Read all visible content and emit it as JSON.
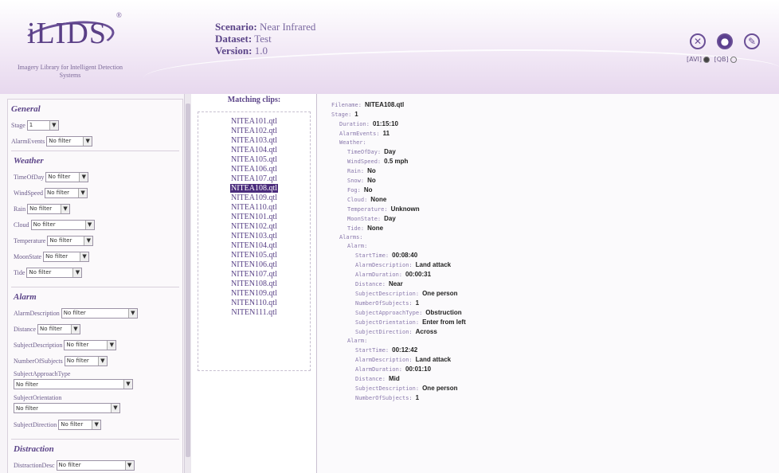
{
  "header": {
    "logo_text": "iLIDS",
    "logo_reg": "®",
    "logo_tagline": "Imagery Library for Intelligent Detection Systems",
    "scenario_label": "Scenario:",
    "scenario_value": "Near Infrared",
    "dataset_label": "Dataset:",
    "dataset_value": "Test",
    "version_label": "Version:",
    "version_value": "1.0",
    "format_options": [
      "[AVI]",
      "[QB]"
    ],
    "icons": [
      "close-icon",
      "record-icon",
      "edit-icon"
    ]
  },
  "filters": {
    "general": {
      "title": "General",
      "stage_label": "Stage",
      "stage_value": "1",
      "alarm_events_label": "AlarmEvents",
      "alarm_events_value": "No filter"
    },
    "weather": {
      "title": "Weather",
      "rows": [
        {
          "label": "TimeOfDay",
          "value": "No filter"
        },
        {
          "label": "WindSpeed",
          "value": "No filter"
        },
        {
          "label": "Rain",
          "value": "No filter"
        },
        {
          "label": "Cloud",
          "value": "No filter"
        },
        {
          "label": "Temperature",
          "value": "No filter"
        },
        {
          "label": "MoonState",
          "value": "No filter"
        },
        {
          "label": "Tide",
          "value": "No filter"
        }
      ]
    },
    "alarm": {
      "title": "Alarm",
      "rows": [
        {
          "label": "AlarmDescription",
          "value": "No filter"
        },
        {
          "label": "Distance",
          "value": "No filter"
        },
        {
          "label": "SubjectDescription",
          "value": "No filter"
        },
        {
          "label": "NumberOfSubjects",
          "value": "No filter"
        }
      ],
      "approach_label": "SubjectApproachType",
      "approach_value": "No filter",
      "orientation_label": "SubjectOrientation",
      "orientation_value": "No filter",
      "direction_label": "SubjectDirection",
      "direction_value": "No filter"
    },
    "distraction": {
      "title": "Distraction",
      "desc_label": "DistractionDesc",
      "desc_value": "No filter"
    }
  },
  "clips": {
    "title": "Matching clips:",
    "items": [
      "NITEA101.qtl",
      "NITEA102.qtl",
      "NITEA103.qtl",
      "NITEA104.qtl",
      "NITEA105.qtl",
      "NITEA106.qtl",
      "NITEA107.qtl",
      "NITEA108.qtl",
      "NITEA109.qtl",
      "NITEA110.qtl",
      "NITEN101.qtl",
      "NITEN102.qtl",
      "NITEN103.qtl",
      "NITEN104.qtl",
      "NITEN105.qtl",
      "NITEN106.qtl",
      "NITEN107.qtl",
      "NITEN108.qtl",
      "NITEN109.qtl",
      "NITEN110.qtl",
      "NITEN111.qtl"
    ],
    "selected_index": 7
  },
  "details": [
    {
      "indent": 0,
      "key": "Filename:",
      "value": "NITEA108.qtl"
    },
    {
      "indent": 0,
      "key": "Stage:",
      "value": "1"
    },
    {
      "indent": 1,
      "key": "Duration:",
      "value": "01:15:10"
    },
    {
      "indent": 1,
      "key": "AlarmEvents:",
      "value": "11"
    },
    {
      "indent": 1,
      "key": "Weather:",
      "value": ""
    },
    {
      "indent": 2,
      "key": "TimeOfDay:",
      "value": "Day"
    },
    {
      "indent": 2,
      "key": "WindSpeed:",
      "value": "0.5 mph"
    },
    {
      "indent": 2,
      "key": "Rain:",
      "value": "No"
    },
    {
      "indent": 2,
      "key": "Snow:",
      "value": "No"
    },
    {
      "indent": 2,
      "key": "Fog:",
      "value": "No"
    },
    {
      "indent": 2,
      "key": "Cloud:",
      "value": "None"
    },
    {
      "indent": 2,
      "key": "Temperature:",
      "value": "Unknown"
    },
    {
      "indent": 2,
      "key": "MoonState:",
      "value": "Day"
    },
    {
      "indent": 2,
      "key": "Tide:",
      "value": "None"
    },
    {
      "indent": 1,
      "key": "Alarms:",
      "value": ""
    },
    {
      "indent": 2,
      "key": "Alarm:",
      "value": ""
    },
    {
      "indent": 3,
      "key": "StartTime:",
      "value": "00:08:40"
    },
    {
      "indent": 3,
      "key": "AlarmDescription:",
      "value": "Land attack"
    },
    {
      "indent": 3,
      "key": "AlarmDuration:",
      "value": "00:00:31"
    },
    {
      "indent": 3,
      "key": "Distance:",
      "value": "Near"
    },
    {
      "indent": 3,
      "key": "SubjectDescription:",
      "value": "One person"
    },
    {
      "indent": 3,
      "key": "NumberOfSubjects:",
      "value": "1"
    },
    {
      "indent": 3,
      "key": "SubjectApproachType:",
      "value": "Obstruction"
    },
    {
      "indent": 3,
      "key": "SubjectOrientation:",
      "value": "Enter from left"
    },
    {
      "indent": 3,
      "key": "SubjectDirection:",
      "value": "Across"
    },
    {
      "indent": 2,
      "key": "Alarm:",
      "value": ""
    },
    {
      "indent": 3,
      "key": "StartTime:",
      "value": "00:12:42"
    },
    {
      "indent": 3,
      "key": "AlarmDescription:",
      "value": "Land attack"
    },
    {
      "indent": 3,
      "key": "AlarmDuration:",
      "value": "00:01:10"
    },
    {
      "indent": 3,
      "key": "Distance:",
      "value": "Mid"
    },
    {
      "indent": 3,
      "key": "SubjectDescription:",
      "value": "One person"
    },
    {
      "indent": 3,
      "key": "NumberOfSubjects:",
      "value": "1"
    }
  ]
}
